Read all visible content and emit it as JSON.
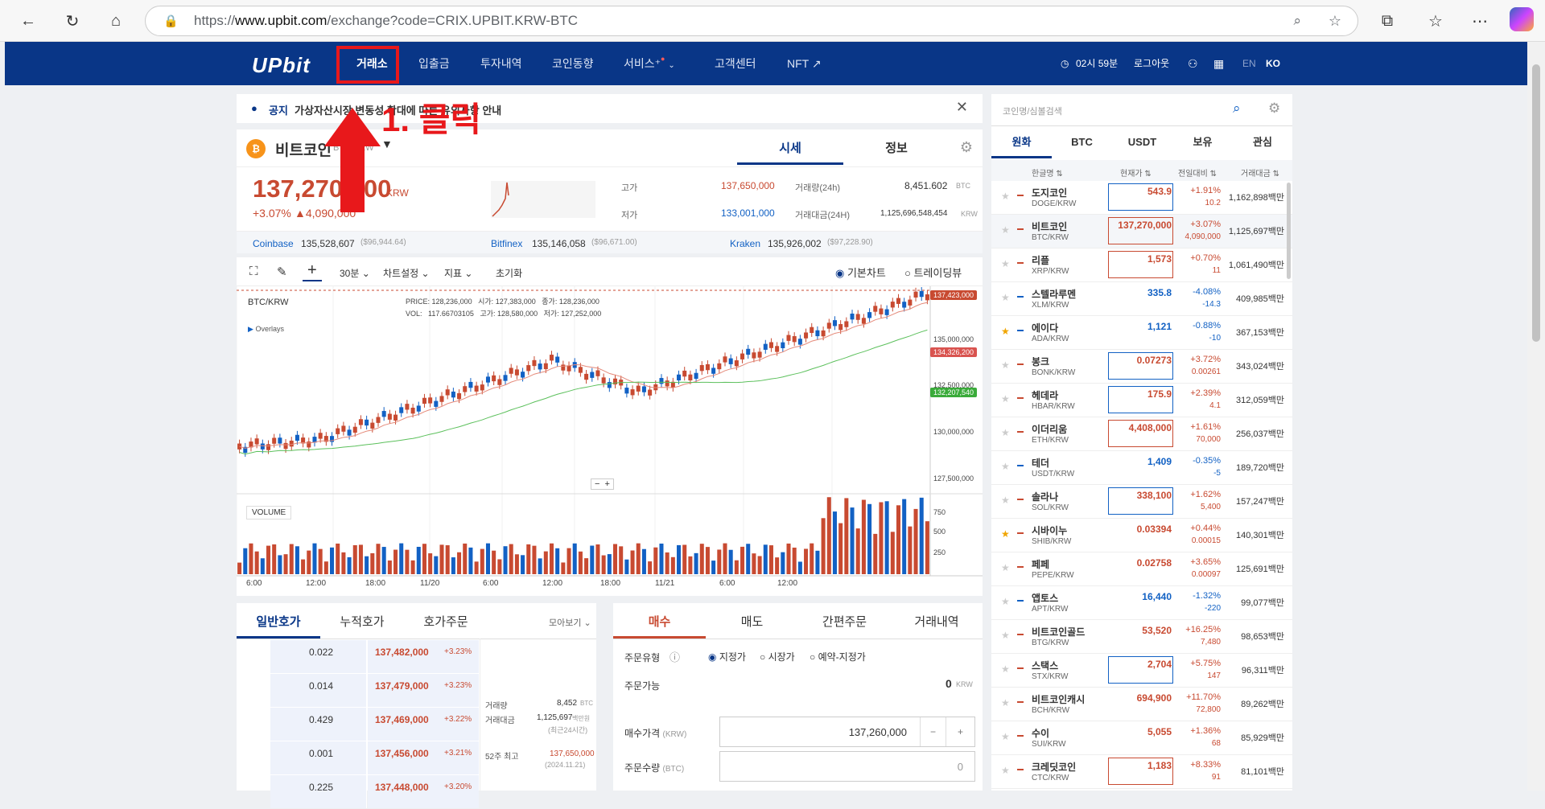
{
  "browser": {
    "url_prefix": "https://",
    "url_host": "www.upbit.com",
    "url_path": "/exchange?code=CRIX.UPBIT.KRW-BTC"
  },
  "header": {
    "logo": "UPbit",
    "nav": [
      "거래소",
      "입출금",
      "투자내역",
      "코인동향",
      "서비스⁺",
      "고객센터",
      "NFT ↗"
    ],
    "time": "02시 59분",
    "logout": "로그아웃",
    "lang_en": "EN",
    "lang_ko": "KO"
  },
  "annotation": {
    "text": "1.  클릭"
  },
  "notice": {
    "label": "공지",
    "text": "가상자산시장 변동성 확대에 따른 유의사항 안내"
  },
  "coin": {
    "name": "비트코인",
    "market": "BTC/KRW",
    "tab_price": "시세",
    "tab_info": "정보",
    "price": "137,270,000",
    "unit": "KRW",
    "change_pct": "+3.07%",
    "change_amt": "▲4,090,000",
    "high_label": "고가",
    "high": "137,650,000",
    "low_label": "저가",
    "low": "133,001,000",
    "vol_label": "거래량(24h)",
    "vol": "8,451.602",
    "vol_unit": "BTC",
    "amt_label": "거래대금(24H)",
    "amt": "1,125,696,548,454",
    "amt_unit": "KRW"
  },
  "exchanges": [
    {
      "name": "Coinbase",
      "price": "135,528,607",
      "usd": "($96,944.64)"
    },
    {
      "name": "Bitfinex",
      "price": "135,146,058",
      "usd": "($96,671.00)"
    },
    {
      "name": "Kraken",
      "price": "135,926,002",
      "usd": "($97,228.90)"
    }
  ],
  "chart_toolbar": {
    "interval": "30분",
    "settings": "차트설정",
    "indicator": "지표",
    "reset": "초기화",
    "basic": "기본차트",
    "tv": "트레이딩뷰"
  },
  "chart_info": {
    "symbol": "BTC/KRW",
    "overlays": "Overlays",
    "price_l": "PRICE:",
    "price": "128,236,000",
    "open_l": "시가:",
    "open": "127,383,000",
    "close_l": "종가:",
    "close": "128,236,000",
    "vol_l": "VOL:",
    "vol": "117.66703105",
    "high_l": "고가:",
    "high": "128,580,000",
    "low_l": "저가:",
    "low": "127,252,000",
    "volume": "VOLUME"
  },
  "chart_tags": {
    "last": "137,423,000",
    "ma1": "134,326,200",
    "ma2": "132,207,540"
  },
  "chart_data": {
    "type": "candlestick",
    "yticks": [
      "135,000,000",
      "132,500,000",
      "130,000,000",
      "127,500,000"
    ],
    "xticks": [
      "6:00",
      "12:00",
      "18:00",
      "11/20",
      "6:00",
      "12:00",
      "18:00",
      "11/21",
      "6:00",
      "12:00"
    ],
    "vol_ticks": [
      "750",
      "500",
      "250"
    ],
    "ylim": [
      125500000,
      138000000
    ]
  },
  "orderbook": {
    "tabs": [
      "일반호가",
      "누적호가",
      "호가주문"
    ],
    "view": "모아보기",
    "rows": [
      {
        "qty": "0.022",
        "price": "137,482,000",
        "pct": "+3.23%"
      },
      {
        "qty": "0.014",
        "price": "137,479,000",
        "pct": "+3.23%"
      },
      {
        "qty": "0.429",
        "price": "137,469,000",
        "pct": "+3.22%"
      },
      {
        "qty": "0.001",
        "price": "137,456,000",
        "pct": "+3.21%"
      },
      {
        "qty": "0.225",
        "price": "137,448,000",
        "pct": "+3.20%"
      }
    ],
    "info": {
      "vol_l": "거래량",
      "vol": "8,452",
      "vol_u": "BTC",
      "amt_l": "거래대금",
      "amt": "1,125,697",
      "amt_u": "백만원",
      "amt_n": "(최근24시간)",
      "h52_l": "52주 최고",
      "h52": "137,650,000",
      "h52_d": "(2024.11.21)"
    }
  },
  "order": {
    "tabs": [
      "매수",
      "매도",
      "간편주문",
      "거래내역"
    ],
    "type_label": "주문유형",
    "types": [
      "지정가",
      "시장가",
      "예약-지정가"
    ],
    "avail_label": "주문가능",
    "avail": "0",
    "avail_u": "KRW",
    "price_label": "매수가격",
    "price_u": "(KRW)",
    "price": "137,260,000",
    "qty_label": "주문수량",
    "qty_u": "(BTC)",
    "qty": "0"
  },
  "market": {
    "search_placeholder": "코인명/심볼검색",
    "tabs": [
      "원화",
      "BTC",
      "USDT",
      "보유",
      "관심"
    ],
    "cols": [
      "한글명 ⇅",
      "현재가 ⇅",
      "전일대비 ⇅",
      "거래대금 ⇅"
    ],
    "rows": [
      {
        "name": "도지코인",
        "mk": "DOGE/KRW",
        "price": "543.9",
        "pct": "+1.91%",
        "chg": "10.2",
        "vol": "1,162,898백만",
        "c": "red",
        "box": "blue",
        "star": false
      },
      {
        "name": "비트코인",
        "mk": "BTC/KRW",
        "price": "137,270,000",
        "pct": "+3.07%",
        "chg": "4,090,000",
        "vol": "1,125,697백만",
        "c": "red",
        "box": "red",
        "star": false
      },
      {
        "name": "리플",
        "mk": "XRP/KRW",
        "price": "1,573",
        "pct": "+0.70%",
        "chg": "11",
        "vol": "1,061,490백만",
        "c": "red",
        "box": "red",
        "star": false
      },
      {
        "name": "스텔라루멘",
        "mk": "XLM/KRW",
        "price": "335.8",
        "pct": "-4.08%",
        "chg": "-14.3",
        "vol": "409,985백만",
        "c": "blue",
        "box": "",
        "star": false
      },
      {
        "name": "에이다",
        "mk": "ADA/KRW",
        "price": "1,121",
        "pct": "-0.88%",
        "chg": "-10",
        "vol": "367,153백만",
        "c": "blue",
        "box": "",
        "star": true
      },
      {
        "name": "봉크",
        "mk": "BONK/KRW",
        "price": "0.07273",
        "pct": "+3.72%",
        "chg": "0.00261",
        "vol": "343,024백만",
        "c": "red",
        "box": "blue",
        "star": false
      },
      {
        "name": "헤데라",
        "mk": "HBAR/KRW",
        "price": "175.9",
        "pct": "+2.39%",
        "chg": "4.1",
        "vol": "312,059백만",
        "c": "red",
        "box": "blue",
        "star": false
      },
      {
        "name": "이더리움",
        "mk": "ETH/KRW",
        "price": "4,408,000",
        "pct": "+1.61%",
        "chg": "70,000",
        "vol": "256,037백만",
        "c": "red",
        "box": "red",
        "star": false
      },
      {
        "name": "테더",
        "mk": "USDT/KRW",
        "price": "1,409",
        "pct": "-0.35%",
        "chg": "-5",
        "vol": "189,720백만",
        "c": "blue",
        "box": "",
        "star": false
      },
      {
        "name": "솔라나",
        "mk": "SOL/KRW",
        "price": "338,100",
        "pct": "+1.62%",
        "chg": "5,400",
        "vol": "157,247백만",
        "c": "red",
        "box": "blue",
        "star": false
      },
      {
        "name": "시바이누",
        "mk": "SHIB/KRW",
        "price": "0.03394",
        "pct": "+0.44%",
        "chg": "0.00015",
        "vol": "140,301백만",
        "c": "red",
        "box": "",
        "star": true
      },
      {
        "name": "페페",
        "mk": "PEPE/KRW",
        "price": "0.02758",
        "pct": "+3.65%",
        "chg": "0.00097",
        "vol": "125,691백만",
        "c": "red",
        "box": "",
        "star": false
      },
      {
        "name": "앱토스",
        "mk": "APT/KRW",
        "price": "16,440",
        "pct": "-1.32%",
        "chg": "-220",
        "vol": "99,077백만",
        "c": "blue",
        "box": "",
        "star": false
      },
      {
        "name": "비트코인골드",
        "mk": "BTG/KRW",
        "price": "53,520",
        "pct": "+16.25%",
        "chg": "7,480",
        "vol": "98,653백만",
        "c": "red",
        "box": "",
        "star": false
      },
      {
        "name": "스택스",
        "mk": "STX/KRW",
        "price": "2,704",
        "pct": "+5.75%",
        "chg": "147",
        "vol": "96,311백만",
        "c": "red",
        "box": "blue",
        "star": false
      },
      {
        "name": "비트코인캐시",
        "mk": "BCH/KRW",
        "price": "694,900",
        "pct": "+11.70%",
        "chg": "72,800",
        "vol": "89,262백만",
        "c": "red",
        "box": "",
        "star": false
      },
      {
        "name": "수이",
        "mk": "SUI/KRW",
        "price": "5,055",
        "pct": "+1.36%",
        "chg": "68",
        "vol": "85,929백만",
        "c": "red",
        "box": "",
        "star": false
      },
      {
        "name": "크레딧코인",
        "mk": "CTC/KRW",
        "price": "1,183",
        "pct": "+8.33%",
        "chg": "91",
        "vol": "81,101백만",
        "c": "red",
        "box": "red",
        "star": false
      }
    ]
  }
}
